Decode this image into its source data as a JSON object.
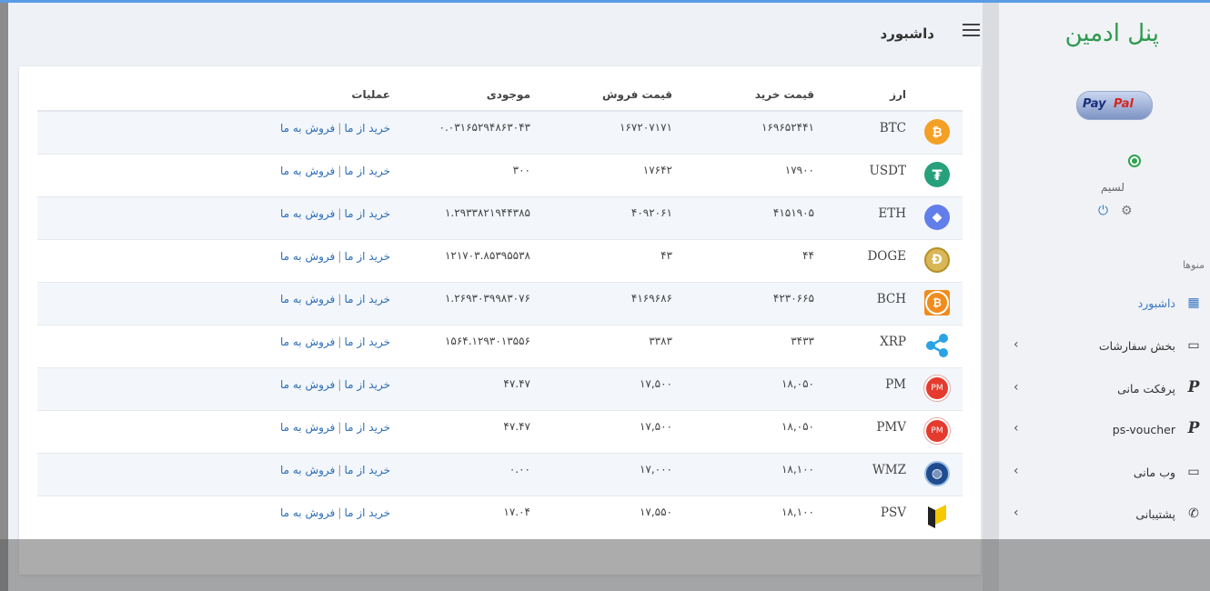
{
  "sidebar": {
    "brand": "پنل ادمین",
    "logo_part1": "Pay",
    "logo_part2": "Pal",
    "username": "لسیم",
    "menu_title": "منوها",
    "items": [
      {
        "label": "داشبورد",
        "icon": "dashboard-icon",
        "glyph": "▦",
        "active": true
      },
      {
        "label": "بخش سفارشات",
        "icon": "card-icon",
        "glyph": "▭",
        "chevron": "‹"
      },
      {
        "label": "پرفکت مانی",
        "icon": "p-icon",
        "glyph": "P",
        "chevron": "‹"
      },
      {
        "label": "ps-voucher",
        "icon": "p-icon",
        "glyph": "P",
        "chevron": "‹"
      },
      {
        "label": "وب مانی",
        "icon": "card-icon",
        "glyph": "▭",
        "chevron": "‹"
      },
      {
        "label": "پشتیبانی",
        "icon": "whatsapp-icon",
        "glyph": "✆",
        "chevron": "‹"
      }
    ]
  },
  "header": {
    "title": "داشبورد"
  },
  "table": {
    "columns": {
      "currency": "ارز",
      "buy": "قیمت خرید",
      "sell": "قیمت فروش",
      "balance": "موجودی",
      "ops": "عملیات"
    },
    "buy_link": "خرید از ما",
    "sell_link": "فروش به ما",
    "sep": "|",
    "rows": [
      {
        "name": "BTC",
        "buy": "۱۶۹۶۵۲۴۴۱",
        "sell": "۱۶۷۲۰۷۱۷۱",
        "balance": "۰.۰۳۱۶۵۲۹۴۸۶۳۰۴۳",
        "icon": "bitcoin-icon",
        "glyph": "₿",
        "cls": "btc"
      },
      {
        "name": "USDT",
        "buy": "۱۷۹۰۰",
        "sell": "۱۷۶۴۲",
        "balance": "۳۰۰",
        "icon": "tether-icon",
        "glyph": "₮",
        "cls": "usdt"
      },
      {
        "name": "ETH",
        "buy": "۴۱۵۱۹۰۵",
        "sell": "۴۰۹۲۰۶۱",
        "balance": "۱.۲۹۳۳۸۲۱۹۴۴۳۸۵",
        "icon": "ethereum-icon",
        "glyph": "◆",
        "cls": "eth"
      },
      {
        "name": "DOGE",
        "buy": "۴۴",
        "sell": "۴۳",
        "balance": "۱۲۱۷۰۳.۸۵۳۹۵۵۳۸",
        "icon": "dogecoin-icon",
        "glyph": "Ð",
        "cls": "doge"
      },
      {
        "name": "BCH",
        "buy": "۴۲۳۰۶۶۵",
        "sell": "۴۱۶۹۶۸۶",
        "balance": "۱.۲۶۹۳۰۳۹۹۸۳۰۷۶",
        "icon": "bitcoin-cash-icon",
        "glyph": "₿",
        "cls": "bch"
      },
      {
        "name": "XRP",
        "buy": "۳۴۳۳",
        "sell": "۳۳۸۳",
        "balance": "۱۵۶۴.۱۲۹۳۰۱۳۵۵۶",
        "icon": "ripple-icon",
        "glyph": "",
        "cls": "xrp"
      },
      {
        "name": "PM",
        "buy": "۱۸,۰۵۰",
        "sell": "۱۷,۵۰۰",
        "balance": "۴۷.۴۷",
        "icon": "perfect-money-icon",
        "glyph": "PM",
        "cls": "pm"
      },
      {
        "name": "PMV",
        "buy": "۱۸,۰۵۰",
        "sell": "۱۷,۵۰۰",
        "balance": "۴۷.۴۷",
        "icon": "perfect-money-icon",
        "glyph": "PM",
        "cls": "pm"
      },
      {
        "name": "WMZ",
        "buy": "۱۸,۱۰۰",
        "sell": "۱۷,۰۰۰",
        "balance": "۰.۰۰",
        "icon": "webmoney-icon",
        "glyph": "◍",
        "cls": "wmz"
      },
      {
        "name": "PSV",
        "buy": "۱۸,۱۰۰",
        "sell": "۱۷,۵۵۰",
        "balance": "۱۷.۰۴",
        "icon": "ps-voucher-icon",
        "glyph": "",
        "cls": "psv"
      }
    ]
  }
}
